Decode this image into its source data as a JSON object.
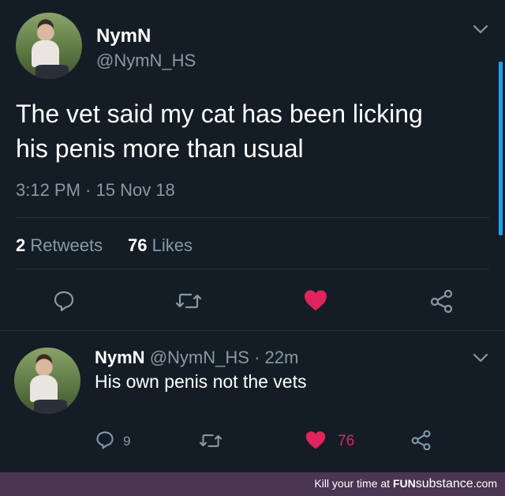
{
  "tweet": {
    "display_name": "NymN",
    "handle": "@NymN_HS",
    "text_line1": "The vet said my cat has been licking",
    "text_line2": "his penis more than usual",
    "timestamp": "3:12 PM · 15 Nov 18",
    "retweets_count": "2",
    "retweets_label": "Retweets",
    "likes_count": "76",
    "likes_label": "Likes"
  },
  "reply": {
    "display_name": "NymN",
    "handle": "@NymN_HS",
    "time": "· 22m",
    "text": "His own penis not the vets",
    "reply_count": "9",
    "like_count": "76"
  },
  "footer": {
    "prefix": "Kill your time at ",
    "brand_a": "FUN",
    "brand_b": "substance",
    "suffix": ".com"
  },
  "colors": {
    "background": "#141d26",
    "like_red": "#e0245e",
    "muted": "#8899a6",
    "accent": "#1da1f2"
  },
  "icons": [
    "reply-icon",
    "retweet-icon",
    "heart-icon",
    "share-icon",
    "chevron-down-icon"
  ]
}
